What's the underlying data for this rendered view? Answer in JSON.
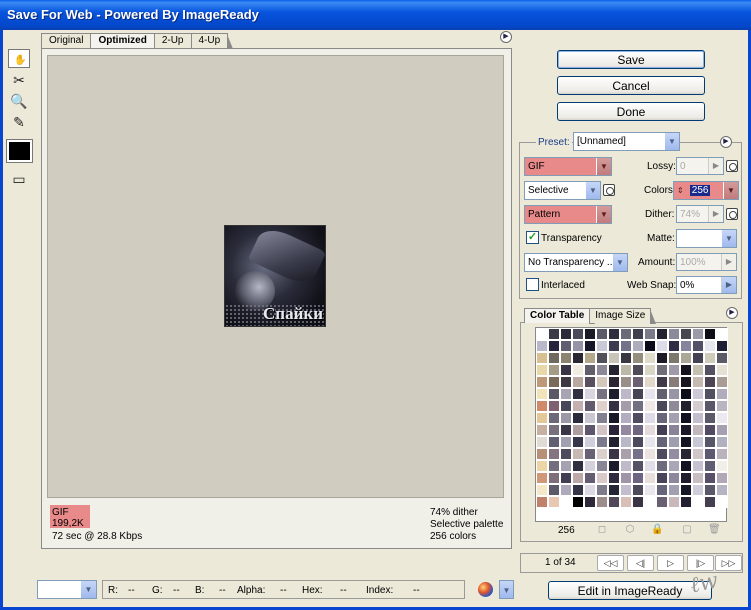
{
  "window": {
    "title": "Save For Web - Powered By ImageReady"
  },
  "tabs": [
    {
      "label": "Original"
    },
    {
      "label": "Optimized"
    },
    {
      "label": "2-Up"
    },
    {
      "label": "4-Up"
    }
  ],
  "preview": {
    "watermark": "Спайки",
    "format": "GIF",
    "size": "199,2K",
    "download": "72 sec @ 28.8 Kbps",
    "dither": "74% dither",
    "palette": "Selective palette",
    "colors": "256 colors"
  },
  "buttons": {
    "save": "Save",
    "cancel": "Cancel",
    "done": "Done",
    "edit": "Edit in ImageReady"
  },
  "settings": {
    "preset_label": "Preset:",
    "preset_value": "[Unnamed]",
    "format": "GIF",
    "reduction": "Selective",
    "dither_algo": "Pattern",
    "lossy_label": "Lossy:",
    "lossy_value": "0",
    "colors_label": "Colors:",
    "colors_value": "256",
    "dither_label": "Dither:",
    "dither_value": "74%",
    "transparency_label": "Transparency",
    "transparency_checked": true,
    "matte_label": "Matte:",
    "transparency_dither": "No Transparency ...",
    "amount_label": "Amount:",
    "amount_value": "100%",
    "interlaced_label": "Interlaced",
    "websnap_label": "Web Snap:",
    "websnap_value": "0%"
  },
  "color_table": {
    "tab_color": "Color Table",
    "tab_size": "Image Size",
    "count": "256",
    "palette": [
      "#ffffff",
      "#3a3a48",
      "#2a2a38",
      "#4a4a58",
      "#1a1a26",
      "#5a5a68",
      "#2e2e3c",
      "#6a6a78",
      "#3e3e4c",
      "#7a7a88",
      "#22222e",
      "#8a8a98",
      "#46464e",
      "#9a9aa8",
      "#0e0e16",
      "#ffffff",
      "#b8b8c8",
      "#24243a",
      "#5e5e70",
      "#9494a6",
      "#16162a",
      "#c8c8d6",
      "#3c3c50",
      "#72728a",
      "#acacbc",
      "#0a0a18",
      "#dcdce8",
      "#2c2c44",
      "#84849c",
      "#505066",
      "#e6e6ee",
      "#1e1e32",
      "#d8c090",
      "#6e6a60",
      "#8a8470",
      "#2a2830",
      "#b4a88a",
      "#525058",
      "#c8c4b8",
      "#3a3640",
      "#968e7c",
      "#e0dccc",
      "#1c1a24",
      "#7c786c",
      "#aaa698",
      "#444250",
      "#d0ccbc",
      "#5c5a64",
      "#e8d8a8",
      "#a49c84",
      "#383444",
      "#f0ece0",
      "#625e6a",
      "#8c8898",
      "#26242e",
      "#bcb8a8",
      "#4e4a56",
      "#dad6c6",
      "#706c78",
      "#9e9aa8",
      "#14121c",
      "#c4c0b0",
      "#545060",
      "#e4e0d4",
      "#c09a78",
      "#7a6a5a",
      "#3e3842",
      "#b8a8a0",
      "#58505c",
      "#d4c8bc",
      "#2c2632",
      "#9a8e88",
      "#6a6070",
      "#e2d8cc",
      "#403a48",
      "#887c78",
      "#1a1620",
      "#c6bab0",
      "#4c4452",
      "#a89c94",
      "#f0e4b8",
      "#5a5864",
      "#a8a4b4",
      "#303040",
      "#d8d4e0",
      "#767282",
      "#1e1e2c",
      "#bcb8c8",
      "#464454",
      "#e8e4ee",
      "#62606e",
      "#9896a6",
      "#0e0e1a",
      "#ccc8d6",
      "#525060",
      "#b0acbc",
      "#d08a6a",
      "#806070",
      "#464658",
      "#c4b0b0",
      "#625a6c",
      "#e0d0cc",
      "#343044",
      "#a49ca8",
      "#707080",
      "#f0e8e4",
      "#4a4858",
      "#8e8a98",
      "#22202e",
      "#d4ccd0",
      "#585668",
      "#b8b4c0",
      "#e4c898",
      "#6c6878",
      "#9c98a8",
      "#2a2a3a",
      "#cac6d2",
      "#828090",
      "#181826",
      "#b2aec0",
      "#4e4c5e",
      "#dedae6",
      "#686678",
      "#a4a0b2",
      "#101020",
      "#c2becc",
      "#5c5a6a",
      "#ece8f0",
      "#c8b0a0",
      "#78707c",
      "#3a3648",
      "#ae9ea0",
      "#5e566a",
      "#d2c4c4",
      "#2a2438",
      "#9488a0",
      "#6e6680",
      "#e4dadc",
      "#443e52",
      "#8a8298",
      "#1c182a",
      "#c0b6bc",
      "#524a60",
      "#a6a0b0",
      "#e0dcd4",
      "#606070",
      "#a0a0b0",
      "#36364a",
      "#d0d0dc",
      "#7a7a8c",
      "#20202e",
      "#b8b8c6",
      "#4a4a5c",
      "#e6e6ec",
      "#646476",
      "#9e9eae",
      "#141424",
      "#c8c8d4",
      "#565666",
      "#b0b0be",
      "#b89078",
      "#847480",
      "#4c4a5a",
      "#c8b8b4",
      "#686274",
      "#dcd0cc",
      "#3a3448",
      "#aaa0ac",
      "#767088",
      "#ece2e0",
      "#504a5e",
      "#948ca0",
      "#282434",
      "#d0c6c8",
      "#5e5870",
      "#bab2bc",
      "#ecd4a4",
      "#726e7e",
      "#a6a2b2",
      "#2e2e3e",
      "#d4d0dc",
      "#888696",
      "#1a1a2a",
      "#bebaca",
      "#545264",
      "#e2dee8",
      "#6e6c7c",
      "#aaa6b6",
      "#121222",
      "#c6c2d0",
      "#605e70",
      "#f2eee8",
      "#d09878",
      "#7e6e7a",
      "#403e50",
      "#bca8a8",
      "#645c70",
      "#d8cac8",
      "#302a3e",
      "#a094a8",
      "#6c6480",
      "#e8dedc",
      "#4a4458",
      "#8e869c",
      "#201c2e",
      "#c8bec2",
      "#585068",
      "#b0a8b6",
      "#f4e8c8",
      "#5c5a68",
      "#aeaabc",
      "#343446",
      "#dcd8e4",
      "#7e7c8c",
      "#242434",
      "#c2bece",
      "#4c4a5a",
      "#eae6ee",
      "#66647a",
      "#a2a0b0",
      "#161626",
      "#ceccd8",
      "#5a5868",
      "#b6b4c2",
      "#c0806a",
      "#e8c8b0",
      "#ffffff",
      "#000000",
      "#2e2838",
      "#9c8c8c",
      "#504858",
      "#d8c0b8",
      "#3a3444",
      "#ffffff",
      "#686070",
      "#c8b8bc",
      "#222030",
      "#ffffff",
      "#443e4e",
      "#ffffff"
    ]
  },
  "pager": {
    "text": "1 of 34"
  },
  "readout": {
    "r_label": "R:",
    "r_value": "--",
    "g_label": "G:",
    "g_value": "--",
    "b_label": "B:",
    "b_value": "--",
    "alpha_label": "Alpha:",
    "alpha_value": "--",
    "hex_label": "Hex:",
    "hex_value": "--",
    "index_label": "Index:",
    "index_value": "--"
  }
}
